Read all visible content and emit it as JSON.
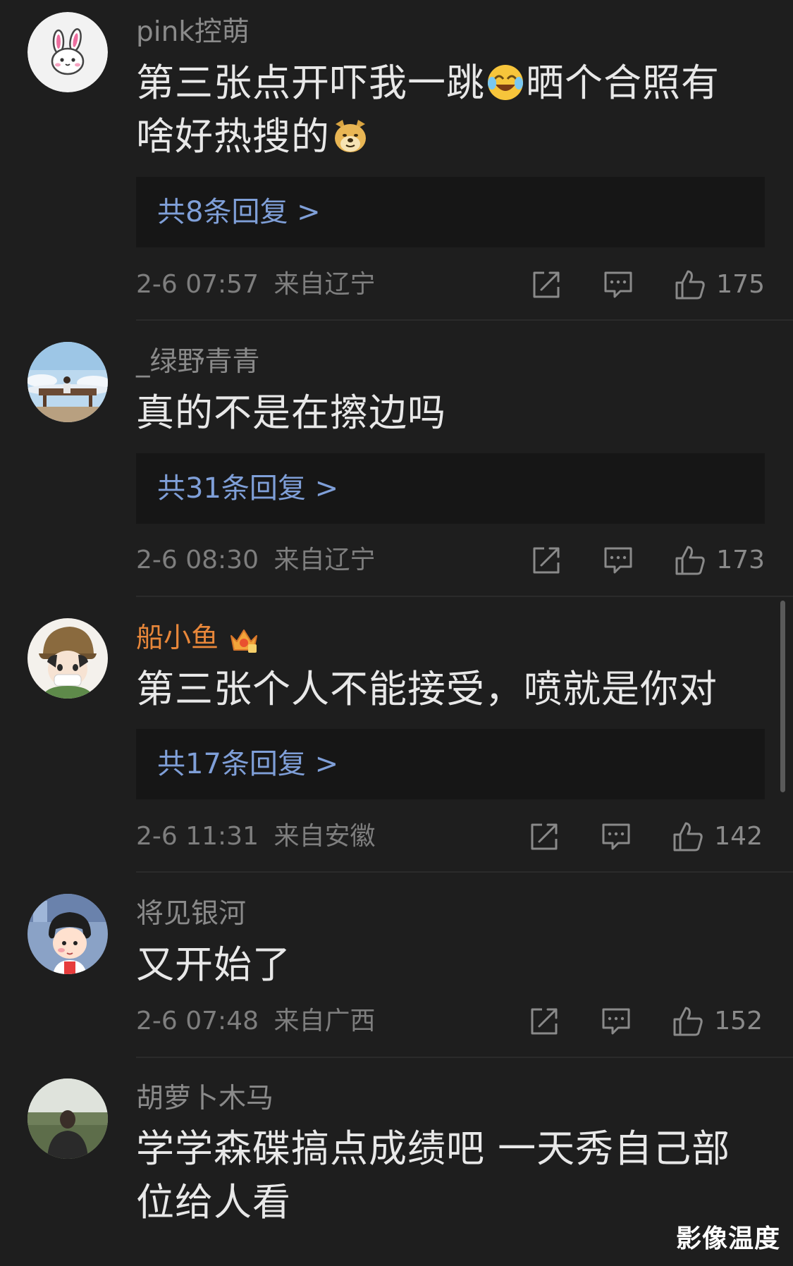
{
  "comments": [
    {
      "username": "pink控萌",
      "text_parts": [
        "第三张点开吓我一跳",
        "晒个合照有",
        "啥好热搜的"
      ],
      "emojis": [
        "laugh-cry-emoji",
        "doge-emoji"
      ],
      "replies": "共8条回复 >",
      "time": "2-6 07:57",
      "location": "来自辽宁",
      "likes": "175"
    },
    {
      "username": "_绿野青青",
      "text": "真的不是在擦边吗",
      "replies": "共31条回复 >",
      "time": "2-6 08:30",
      "location": "来自辽宁",
      "likes": "173"
    },
    {
      "username": "船小鱼",
      "badge": "crown-badge-icon",
      "text": "第三张个人不能接受，喷就是你对",
      "replies": "共17条回复 >",
      "time": "2-6 11:31",
      "location": "来自安徽",
      "likes": "142"
    },
    {
      "username": "将见银河",
      "text": "又开始了",
      "time": "2-6 07:48",
      "location": "来自广西",
      "likes": "152"
    },
    {
      "username": "胡萝卜木马",
      "text_lines": [
        "学学森碟搞点成绩吧 一天秀自己部",
        "位给人看"
      ]
    }
  ],
  "watermark": "影像温度",
  "colors": {
    "background": "#1e1e1e",
    "reply_box": "#161616",
    "link": "#7f9fd8",
    "vip_name": "#e8873a"
  }
}
